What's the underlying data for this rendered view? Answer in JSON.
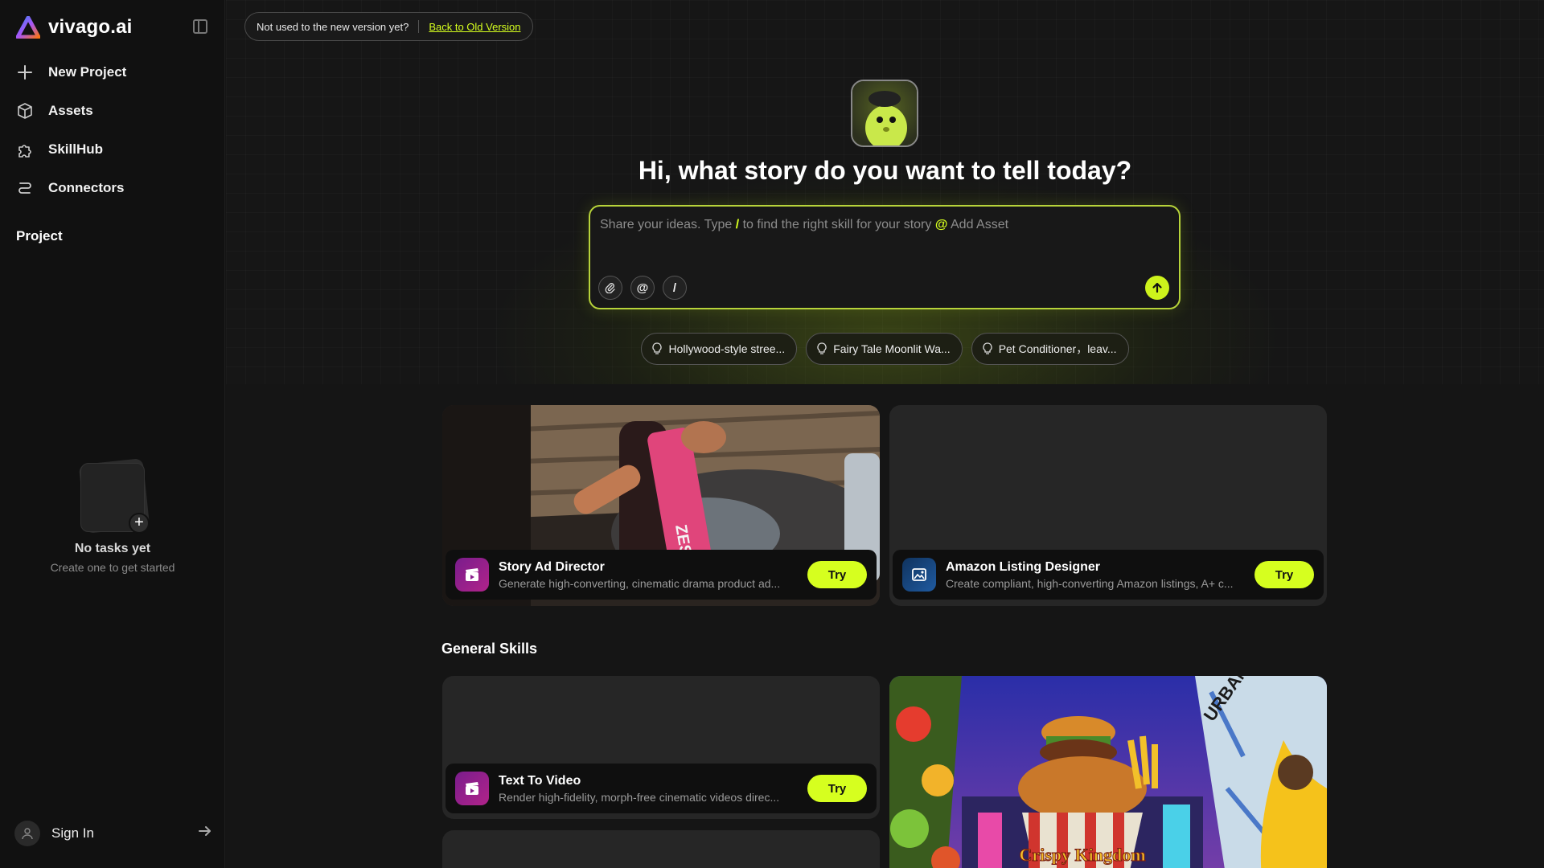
{
  "app": {
    "name": "vivago.ai"
  },
  "sidebar": {
    "nav": [
      {
        "label": "New Project",
        "icon": "plus-icon"
      },
      {
        "label": "Assets",
        "icon": "box-icon"
      },
      {
        "label": "SkillHub",
        "icon": "puzzle-icon"
      },
      {
        "label": "Connectors",
        "icon": "link-icon"
      }
    ],
    "section_label": "Project",
    "empty": {
      "title": "No tasks yet",
      "subtitle": "Create one to get started"
    },
    "signin_label": "Sign In"
  },
  "banner": {
    "text": "Not used to the new version yet?",
    "link": "Back to Old Version"
  },
  "hero": {
    "title": "Hi, what story do you want to tell today?",
    "placeholder_part1": "Share your ideas. Type",
    "placeholder_slash": "/",
    "placeholder_part2": "to find the right skill for your story",
    "placeholder_at": "@",
    "placeholder_part3": "Add Asset",
    "tool_at": "@",
    "tool_slash": "/"
  },
  "chips": [
    "Hollywood-style stree...",
    "Fairy Tale Moonlit Wa...",
    "Pet Conditioner，leav..."
  ],
  "cards": {
    "story_ad": {
      "title": "Story Ad Director",
      "desc": "Generate high-converting, cinematic drama product ad...",
      "try": "Try"
    },
    "amazon": {
      "title": "Amazon Listing Designer",
      "desc": "Create compliant, high-converting Amazon listings, A+ c...",
      "try": "Try"
    },
    "text_to_video": {
      "title": "Text To Video",
      "desc": "Render high-fidelity, morph-free cinematic videos direc...",
      "try": "Try"
    }
  },
  "general_skills_title": "General Skills",
  "artwork": {
    "can_text": "ZESTRA",
    "poster_text": "Crispy Kingdom",
    "urban_text": "URBAN"
  },
  "colors": {
    "accent": "#d6ff1f",
    "background": "#141414",
    "sidebar": "#111111"
  }
}
